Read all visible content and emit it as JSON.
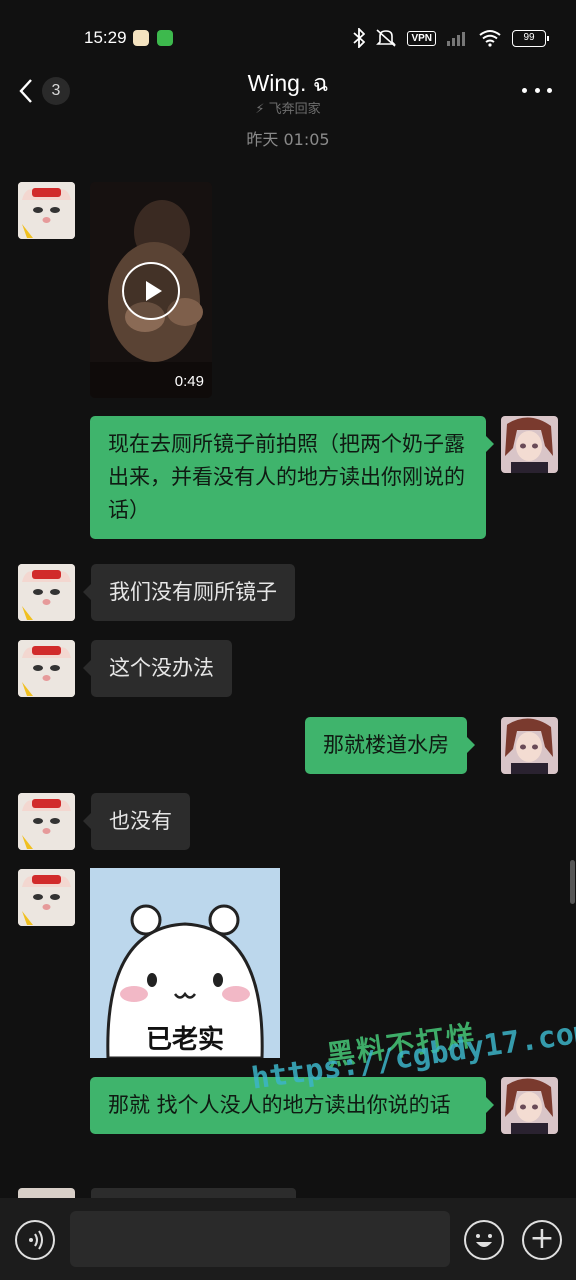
{
  "status_bar": {
    "time": "15:29",
    "vpn": "VPN",
    "battery": "99"
  },
  "header": {
    "back_count": "3",
    "title": "Wing. ฉ",
    "subtitle": "飞奔回家"
  },
  "timestamp": "昨天 01:05",
  "messages": [
    {
      "side": "left",
      "type": "video",
      "duration": "0:49"
    },
    {
      "side": "right",
      "type": "text",
      "text": "现在去厕所镜子前拍照（把两个奶子露出来，并看没有人的地方读出你刚说的话）"
    },
    {
      "side": "left",
      "type": "text",
      "text": "我们没有厕所镜子"
    },
    {
      "side": "left",
      "type": "text",
      "text": "这个没办法"
    },
    {
      "side": "right",
      "type": "text",
      "text": "那就楼道水房"
    },
    {
      "side": "left",
      "type": "text",
      "text": "也没有"
    },
    {
      "side": "left",
      "type": "sticker",
      "text": "已老实"
    },
    {
      "side": "right",
      "type": "text",
      "text": "那就 找个人没人的地方读出你说的话"
    }
  ],
  "watermark": {
    "line1": "黑料不打烊",
    "line2": "https://cgbdy17.com"
  },
  "colors": {
    "background": "#111111",
    "bubble_left": "#2c2c2c",
    "bubble_right": "#3fb46c"
  },
  "icons": [
    "back-arrow-icon",
    "more-icon",
    "voice-icon",
    "emoji-icon",
    "plus-icon",
    "play-icon"
  ]
}
